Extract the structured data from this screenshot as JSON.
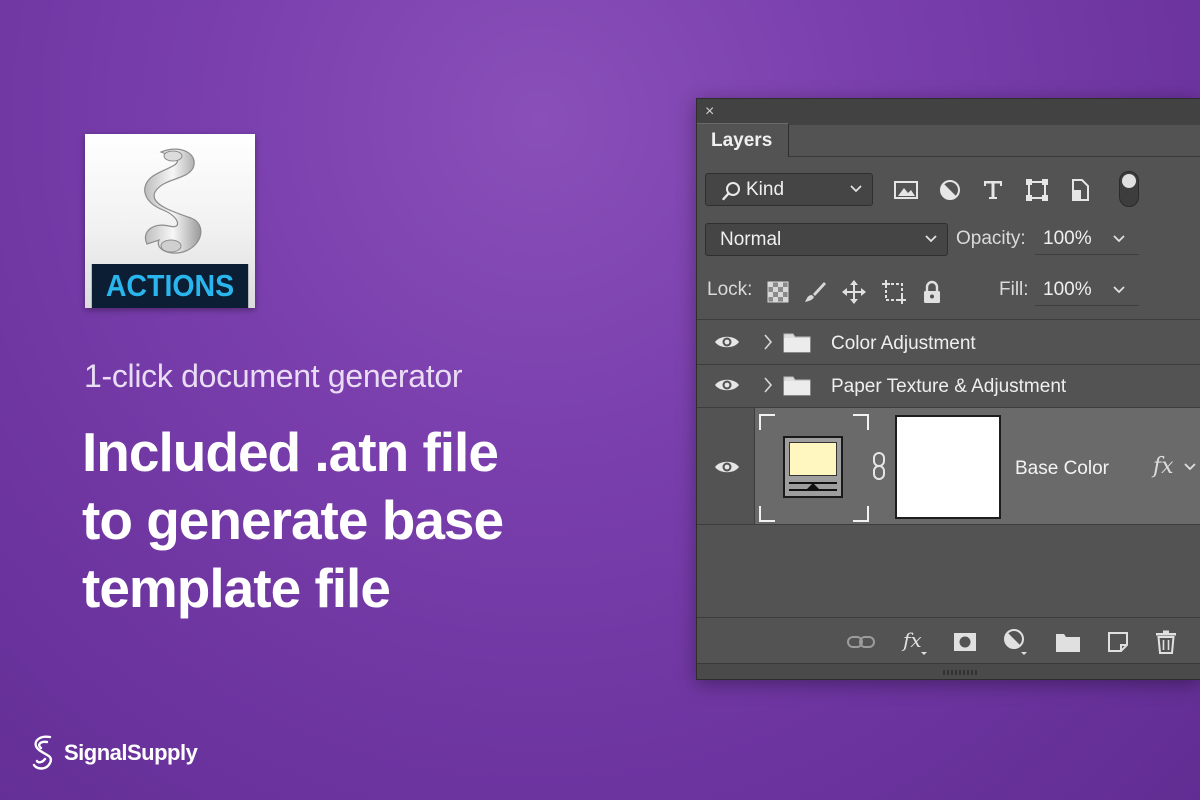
{
  "hero": {
    "icon_label": "ACTIONS",
    "subtitle": "1-click document generator",
    "headline": [
      "Included .atn file",
      "to generate base",
      "template file"
    ],
    "brand": "SignalSupply"
  },
  "panel": {
    "close_glyph": "×",
    "tab": "Layers",
    "filter": {
      "value": "Kind"
    },
    "blend_mode": "Normal",
    "opacity_label": "Opacity:",
    "opacity_value": "100%",
    "lock_label": "Lock:",
    "fill_label": "Fill:",
    "fill_value": "100%",
    "layers": [
      {
        "name": "Color Adjustment",
        "type": "group",
        "visible": true
      },
      {
        "name": "Paper Texture & Adjustment",
        "type": "group",
        "visible": true
      },
      {
        "name": "Base Color",
        "type": "adjustment",
        "visible": true,
        "selected": true,
        "fx": "fx"
      }
    ],
    "adjustment_swatch_color": "#fff6c0"
  },
  "colors": {
    "bg_purple": "#7a3fad",
    "panel_bg": "#535353",
    "icon_text": "#29b6ee"
  },
  "icons": [
    "close-icon",
    "search-icon",
    "image-filter-icon",
    "adjustment-filter-icon",
    "type-filter-icon",
    "shape-filter-icon",
    "smart-object-filter-icon",
    "lock-pixels-icon",
    "brush-icon",
    "move-icon",
    "artboard-icon",
    "lock-icon",
    "eye-icon",
    "folder-icon",
    "link-icon",
    "fx-icon",
    "mask-icon",
    "new-fill-icon",
    "new-group-icon",
    "new-layer-icon",
    "trash-icon"
  ]
}
